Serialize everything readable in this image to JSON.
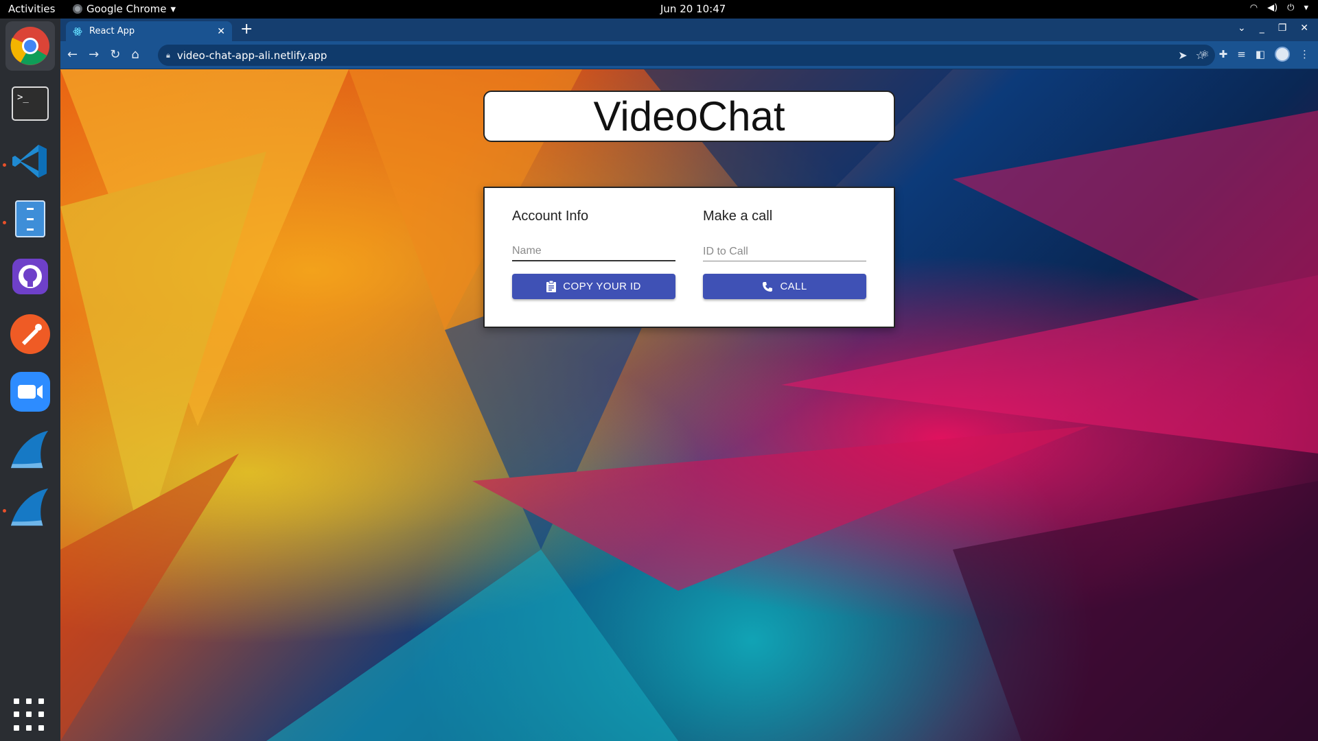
{
  "topbar": {
    "activities": "Activities",
    "app_name": "Google Chrome",
    "clock": "Jun 20  10:47"
  },
  "browser": {
    "tab_title": "React App",
    "url": "video-chat-app-ali.netlify.app"
  },
  "page": {
    "title": "VideoChat",
    "account": {
      "heading": "Account Info",
      "name_placeholder": "Name",
      "copy_button": "COPY YOUR ID"
    },
    "call": {
      "heading": "Make a call",
      "id_placeholder": "ID to Call",
      "call_button": "CALL"
    }
  },
  "dock": {
    "apps": [
      "chrome-icon",
      "terminal-icon",
      "vscode-icon",
      "file-manager-icon",
      "github-desktop-icon",
      "postman-icon",
      "zoom-icon",
      "wireshark-icon",
      "wireshark-icon"
    ]
  }
}
